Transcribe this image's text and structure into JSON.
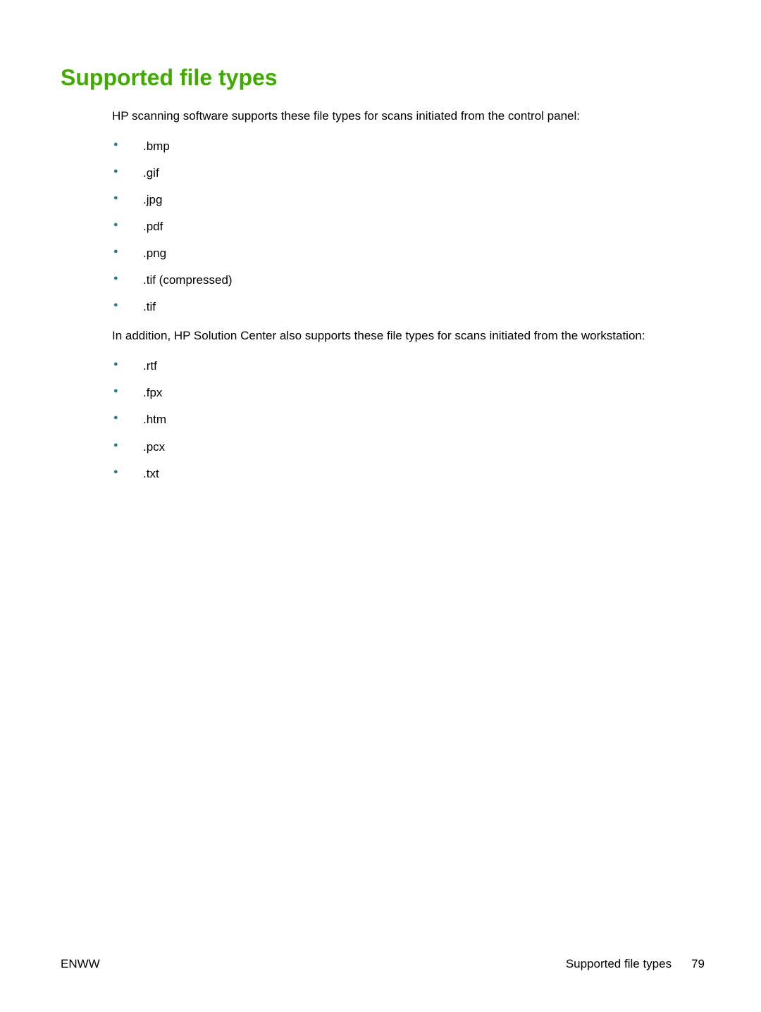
{
  "heading": "Supported file types",
  "intro1": "HP scanning software supports these file types for scans initiated from the control panel:",
  "list1": [
    ".bmp",
    ".gif",
    ".jpg",
    ".pdf",
    ".png",
    ".tif (compressed)",
    ".tif"
  ],
  "intro2": "In addition, HP Solution Center also supports these file types for scans initiated from the workstation:",
  "list2": [
    ".rtf",
    ".fpx",
    ".htm",
    ".pcx",
    ".txt"
  ],
  "footer": {
    "left": "ENWW",
    "rightLabel": "Supported file types",
    "pageNumber": "79"
  }
}
